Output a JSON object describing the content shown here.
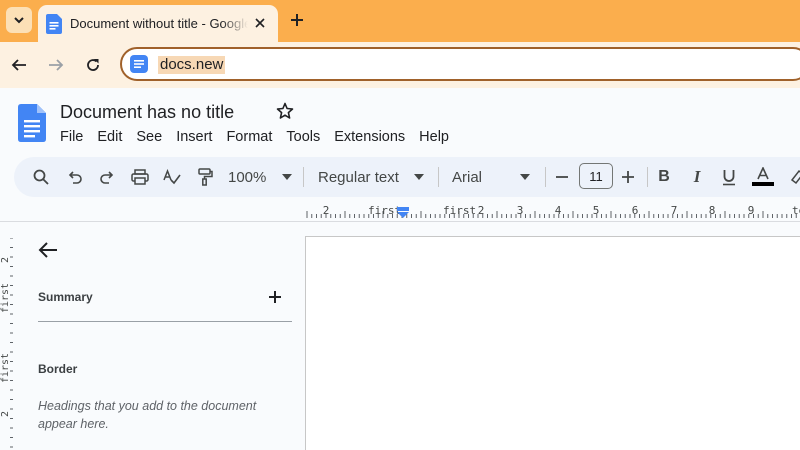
{
  "browser": {
    "tab_title": "Document without title - Google Docs",
    "url": "docs.new",
    "colors": {
      "tabstrip": "#fbae4d",
      "toolbar": "#fdf1e1",
      "omnibox_border": "#a0612a"
    }
  },
  "docs": {
    "title": "Document has no title",
    "menu": [
      "File",
      "Edit",
      "See",
      "Insert",
      "Format",
      "Tools",
      "Extensions",
      "Help"
    ],
    "toolbar": {
      "zoom": "100%",
      "style": "Regular text",
      "font": "Arial",
      "font_size": "11",
      "text_color": "#000000"
    },
    "ruler": {
      "h_labels": [
        "2",
        "first",
        "first",
        "2",
        "3",
        "4",
        "5",
        "6",
        "7",
        "8",
        "9",
        "ten"
      ],
      "v_labels": [
        "2",
        "first",
        "first",
        "2"
      ]
    },
    "outline": {
      "summary_label": "Summary",
      "heading_label": "Border",
      "empty_text": "Headings that you add to the document appear here."
    },
    "icons": [
      "search-icon",
      "undo-icon",
      "redo-icon",
      "print-icon",
      "spellcheck-icon",
      "paint-format-icon",
      "chevron-down-icon",
      "minus-icon",
      "plus-icon",
      "bold-icon",
      "italic-icon",
      "underline-icon",
      "text-color-icon",
      "highlight-icon",
      "star-icon",
      "back-arrow-icon"
    ]
  }
}
